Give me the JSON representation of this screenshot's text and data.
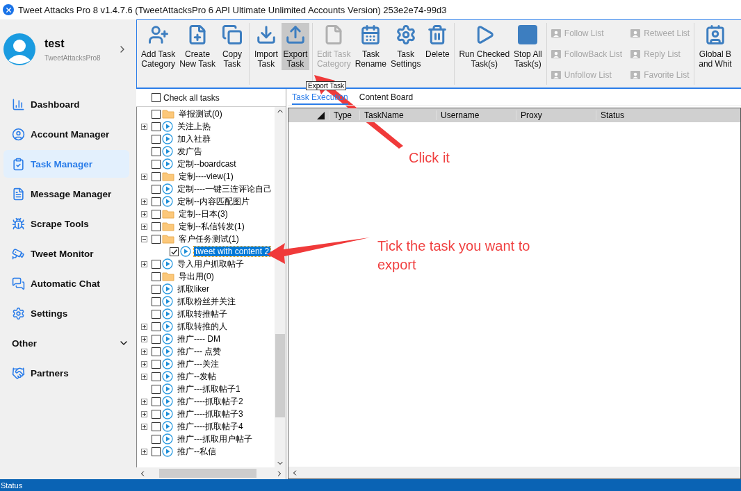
{
  "window": {
    "title": "Tweet Attacks Pro 8 v1.4.7.6 (TweetAttacksPro 6 API Ultimate Unlimited Accounts Version) 253e2e74-99d3"
  },
  "profile": {
    "name": "test",
    "subtitle": "TweetAttacksPro8"
  },
  "sidebar": {
    "items": [
      {
        "label": "Dashboard",
        "kind": "item",
        "selected": false
      },
      {
        "label": "Account Manager",
        "kind": "item",
        "selected": false
      },
      {
        "label": "Task Manager",
        "kind": "item",
        "selected": true
      },
      {
        "label": "Message Manager",
        "kind": "item",
        "selected": false
      },
      {
        "label": "Scrape Tools",
        "kind": "item",
        "selected": false
      },
      {
        "label": "Tweet Monitor",
        "kind": "item",
        "selected": false
      },
      {
        "label": "Automatic Chat",
        "kind": "item",
        "selected": false
      },
      {
        "label": "Settings",
        "kind": "item",
        "selected": false
      },
      {
        "label": "Other",
        "kind": "section",
        "expanded": false
      },
      {
        "label": "Partners",
        "kind": "item",
        "selected": false
      }
    ]
  },
  "toolbar": {
    "groups": [
      [
        {
          "lines": [
            "Add Task",
            "Category"
          ],
          "disabled": false,
          "selected": false
        },
        {
          "lines": [
            "Create",
            "New Task"
          ],
          "disabled": false,
          "selected": false
        },
        {
          "lines": [
            "Copy",
            "Task"
          ],
          "disabled": false,
          "selected": false
        }
      ],
      [
        {
          "lines": [
            "Import",
            "Task"
          ],
          "disabled": false,
          "selected": false
        },
        {
          "lines": [
            "Export",
            "Task"
          ],
          "disabled": false,
          "selected": true
        }
      ],
      [
        {
          "lines": [
            "Edit Task",
            "Category"
          ],
          "disabled": true,
          "selected": false
        },
        {
          "lines": [
            "Task",
            "Rename"
          ],
          "disabled": false,
          "selected": false
        },
        {
          "lines": [
            "Task",
            "Settings"
          ],
          "disabled": false,
          "selected": false
        },
        {
          "lines": [
            "Delete"
          ],
          "disabled": false,
          "selected": false
        }
      ],
      [
        {
          "lines": [
            "Run Checked",
            "Task(s)"
          ],
          "disabled": false,
          "selected": false
        },
        {
          "lines": [
            "Stop All",
            "Task(s)"
          ],
          "disabled": false,
          "selected": false
        }
      ]
    ],
    "lists": [
      {
        "label": "Follow List",
        "disabled": true
      },
      {
        "label": "FollowBack List",
        "disabled": true
      },
      {
        "label": "Unfollow List",
        "disabled": true
      },
      {
        "label": "Retweet List",
        "disabled": true
      },
      {
        "label": "Reply List",
        "disabled": true
      },
      {
        "label": "Favorite List",
        "disabled": true
      }
    ],
    "last": {
      "lines": [
        "Global B",
        "and Whit"
      ],
      "disabled": false,
      "selected": false
    }
  },
  "tooltip": "Export Task",
  "tree": {
    "check_all": {
      "label": "Check all tasks",
      "checked": false
    },
    "items": [
      {
        "label": "举报测试(0)",
        "kind": "folder",
        "expandable": false,
        "checked": false,
        "selected": false
      },
      {
        "label": "关注上热",
        "kind": "task",
        "expandable": true,
        "expanded": false,
        "checked": false,
        "selected": false
      },
      {
        "label": "加入社群",
        "kind": "task",
        "expandable": false,
        "checked": false,
        "selected": false
      },
      {
        "label": "发广告",
        "kind": "task",
        "expandable": false,
        "checked": false,
        "selected": false
      },
      {
        "label": "定制--boardcast",
        "kind": "task",
        "expandable": false,
        "checked": false,
        "selected": false
      },
      {
        "label": "定制----view(1)",
        "kind": "folder",
        "expandable": true,
        "expanded": false,
        "checked": false,
        "selected": false
      },
      {
        "label": "定制----一键三连评论自己",
        "kind": "task",
        "expandable": false,
        "checked": false,
        "selected": false
      },
      {
        "label": "定制--内容匹配图片",
        "kind": "task",
        "expandable": true,
        "expanded": false,
        "checked": false,
        "selected": false
      },
      {
        "label": "定制--日本(3)",
        "kind": "folder",
        "expandable": true,
        "expanded": false,
        "checked": false,
        "selected": false
      },
      {
        "label": "定制--私信转发(1)",
        "kind": "folder",
        "expandable": true,
        "expanded": false,
        "checked": false,
        "selected": false
      },
      {
        "label": "客户任务测试(1)",
        "kind": "folder",
        "expandable": true,
        "expanded": true,
        "checked": false,
        "selected": false,
        "children": [
          {
            "label": "tweet with content 2",
            "kind": "task",
            "expandable": false,
            "checked": true,
            "selected": true
          }
        ]
      },
      {
        "label": "导入用户抓取帖子",
        "kind": "task",
        "expandable": true,
        "expanded": false,
        "checked": false,
        "selected": false
      },
      {
        "label": "导出用(0)",
        "kind": "folder",
        "expandable": false,
        "checked": false,
        "selected": false
      },
      {
        "label": "抓取liker",
        "kind": "task",
        "expandable": false,
        "checked": false,
        "selected": false
      },
      {
        "label": "抓取粉丝并关注",
        "kind": "task",
        "expandable": false,
        "checked": false,
        "selected": false
      },
      {
        "label": "抓取转推帖子",
        "kind": "task",
        "expandable": false,
        "checked": false,
        "selected": false
      },
      {
        "label": "抓取转推的人",
        "kind": "task",
        "expandable": true,
        "expanded": false,
        "checked": false,
        "selected": false
      },
      {
        "label": "推广---- DM",
        "kind": "task",
        "expandable": true,
        "expanded": false,
        "checked": false,
        "selected": false
      },
      {
        "label": "推广--- 点赞",
        "kind": "task",
        "expandable": true,
        "expanded": false,
        "checked": false,
        "selected": false
      },
      {
        "label": "推广---关注",
        "kind": "task",
        "expandable": true,
        "expanded": false,
        "checked": false,
        "selected": false
      },
      {
        "label": "推广--发帖",
        "kind": "task",
        "expandable": true,
        "expanded": false,
        "checked": false,
        "selected": false
      },
      {
        "label": "推广---抓取帖子1",
        "kind": "task",
        "expandable": false,
        "checked": false,
        "selected": false
      },
      {
        "label": "推广----抓取帖子2",
        "kind": "task",
        "expandable": true,
        "expanded": false,
        "checked": false,
        "selected": false
      },
      {
        "label": "推广----抓取帖子3",
        "kind": "task",
        "expandable": true,
        "expanded": false,
        "checked": false,
        "selected": false
      },
      {
        "label": "推广----抓取帖子4",
        "kind": "task",
        "expandable": true,
        "expanded": false,
        "checked": false,
        "selected": false
      },
      {
        "label": "推广---抓取用户帖子",
        "kind": "task",
        "expandable": false,
        "checked": false,
        "selected": false
      },
      {
        "label": "推广--私信",
        "kind": "task",
        "expandable": true,
        "expanded": false,
        "checked": false,
        "selected": false
      }
    ]
  },
  "tabs": [
    {
      "label": "Task Execution",
      "selected": true
    },
    {
      "label": "Content Board",
      "selected": false
    }
  ],
  "table": {
    "columns": [
      "Type",
      "TaskName",
      "Username",
      "Proxy",
      "Status"
    ]
  },
  "annotations": [
    {
      "text": "Click it"
    },
    {
      "text": "Tick the task you want to export"
    }
  ],
  "status_bar": "Status"
}
